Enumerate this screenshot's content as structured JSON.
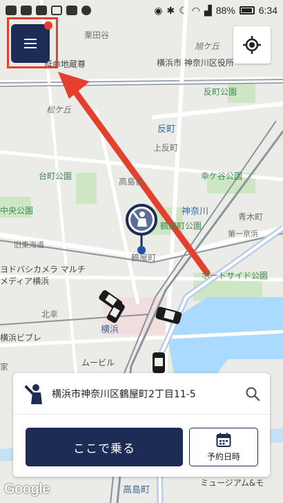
{
  "status_bar": {
    "battery": "88%",
    "time": "6:34"
  },
  "map": {
    "labels": {
      "kuritagaya": "栗田谷",
      "asahigaoka": "旭ケ丘",
      "yokohama_kanagawa": "横浜市 神奈川区役所",
      "jizoson": "延命地蔵尊",
      "hiraoka_park": "反町公園",
      "matsugaoka": "松ケ丘",
      "tanmachi_station": "反町",
      "kamitanmachi": "上反町",
      "daimachi_park": "台町公園",
      "kokagaya_park": "幸ケ谷公園",
      "takashimadai": "高島台",
      "kanagawa_station": "神奈川",
      "chuo_park": "中央公園",
      "tsuruyacho_park": "鶴屋町公園",
      "aokicho": "青木町",
      "tokaido": "旧東海道",
      "daiichi_keihin": "第一京浜",
      "tsuruyacho": "鶴屋町",
      "yodobashi": "ヨドバシカメラ マルチメディア横浜",
      "portside_park": "ポートサイド公園",
      "kitasaiwai": "北幸",
      "yokohama": "横浜",
      "yokohama_bible": "横浜ビブレ",
      "moviele": "ムービル",
      "museum": "ミュージアム&モ",
      "takashimacho": "高島町",
      "ie": "家"
    }
  },
  "card": {
    "address": "横浜市神奈川区鶴屋町2丁目11-5",
    "ride_button": "ここで乗る",
    "reserve_button": "予約日時"
  },
  "attribution": "Google",
  "colors": {
    "navy": "#1c2c55",
    "highlight_red": "#e5402d"
  }
}
